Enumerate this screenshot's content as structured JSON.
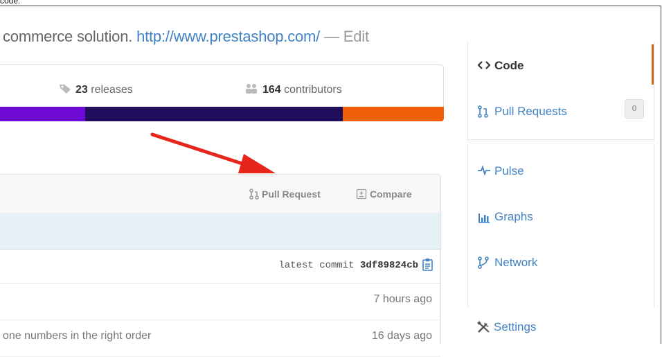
{
  "top_note": "code:",
  "repo": {
    "description_prefix": "commerce solution.",
    "url": "http://www.prestashop.com/",
    "separator": "—",
    "edit_label": "Edit"
  },
  "stats": {
    "releases_count": "23",
    "releases_label": "releases",
    "contributors_count": "164",
    "contributors_label": "contributors"
  },
  "language_bar": {
    "colors": [
      "#6e0ad6",
      "#1e0e5c",
      "#f0600a"
    ],
    "segments": [
      {
        "color": "#6e0ad6"
      },
      {
        "color": "#1e0e5c"
      },
      {
        "color": "#f0600a"
      }
    ]
  },
  "file_header": {
    "pull_request_label": "Pull Request",
    "compare_label": "Compare"
  },
  "latest_commit": {
    "label": "latest commit",
    "hash": "3df89824cb"
  },
  "file_rows": [
    {
      "message": "",
      "age": "7 hours ago"
    },
    {
      "message": "one numbers in the right order",
      "age": "16 days ago"
    }
  ],
  "sidebar": {
    "accent_color": "#d26911",
    "items": [
      {
        "label": "Code",
        "icon": "code-icon",
        "active": true
      },
      {
        "label": "Pull Requests",
        "icon": "pull-request-icon",
        "count": "0"
      },
      {
        "label": "Pulse",
        "icon": "pulse-icon"
      },
      {
        "label": "Graphs",
        "icon": "graph-icon"
      },
      {
        "label": "Network",
        "icon": "network-icon"
      },
      {
        "label": "Settings",
        "icon": "settings-icon"
      }
    ]
  },
  "annotation": {
    "arrow_color": "#e8251b"
  }
}
